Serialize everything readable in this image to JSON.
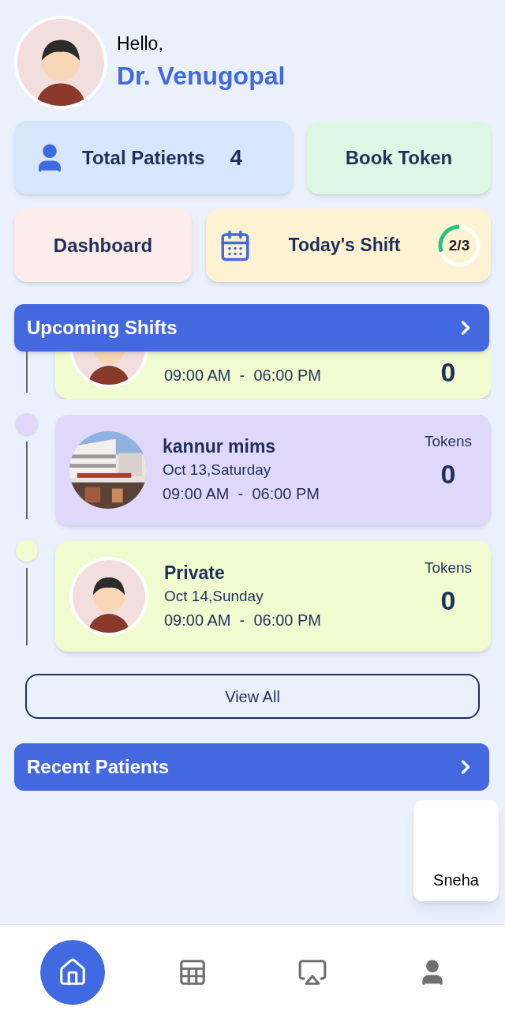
{
  "greeting": {
    "hello": "Hello,",
    "name": "Dr. Venugopal"
  },
  "total_patients": {
    "label": "Total Patients",
    "count": "4"
  },
  "book_token": {
    "label": "Book Token"
  },
  "dashboard": {
    "label": "Dashboard"
  },
  "todays_shift": {
    "label": "Today's Shift",
    "progress": "2/3"
  },
  "upcoming_shifts": {
    "title": "Upcoming Shifts",
    "shifts": [
      {
        "kind": "person",
        "color": "#f1fbd0",
        "time_start": "09:00 AM",
        "separator": "-",
        "time_end": "06:00 PM",
        "tokens": "0"
      },
      {
        "kind": "picture",
        "color": "#e0d8fb",
        "place": "kannur mims",
        "date": "Oct 13,Saturday",
        "time_start": "09:00 AM",
        "separator": "-",
        "time_end": "06:00 PM",
        "tokens_label": "Tokens",
        "tokens": "0"
      },
      {
        "kind": "person",
        "color": "#f1fbd0",
        "place": "Private",
        "date": "Oct 14,Sunday",
        "time_start": "09:00 AM",
        "separator": "-",
        "time_end": "06:00 PM",
        "tokens_label": "Tokens",
        "tokens": "0"
      }
    ],
    "view_all": "View All"
  },
  "recent_patients": {
    "title": "Recent Patients",
    "patients": [
      {
        "name": "Sneha"
      }
    ]
  },
  "nav": [
    {
      "kind": "home",
      "selected": true
    },
    {
      "kind": "schedule",
      "selected": false
    },
    {
      "kind": "cast",
      "selected": false
    },
    {
      "kind": "profile",
      "selected": false
    }
  ]
}
